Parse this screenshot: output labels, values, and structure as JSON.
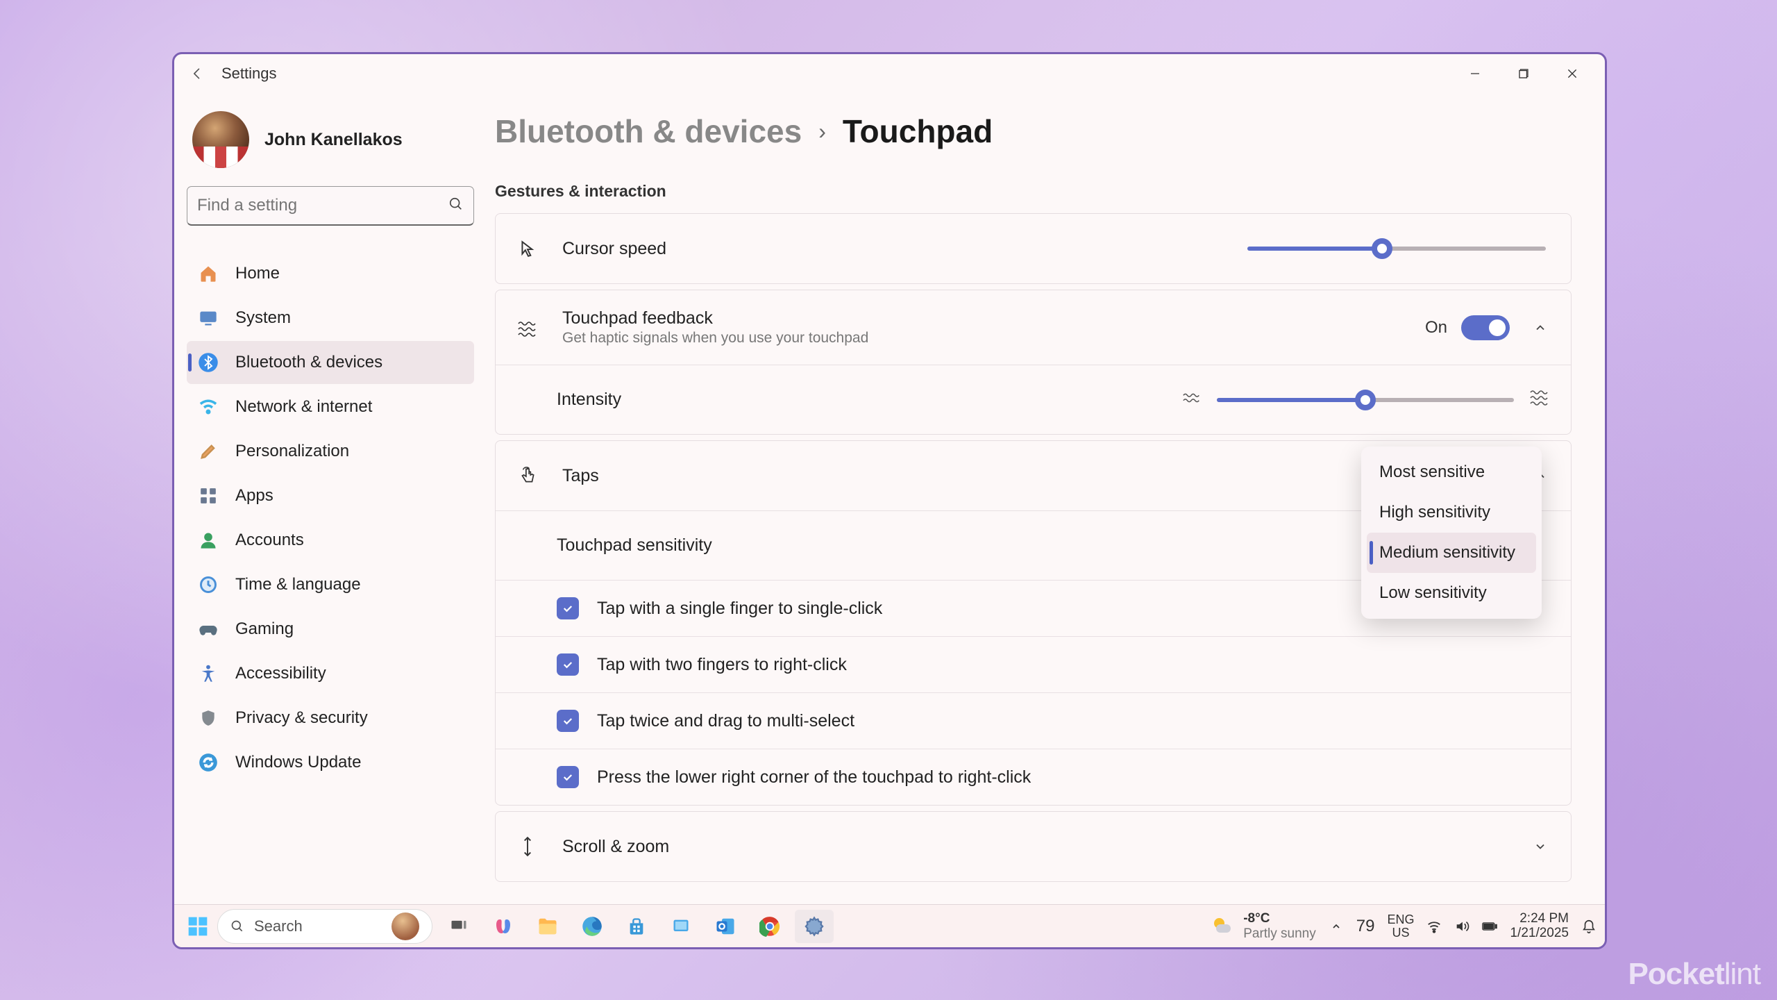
{
  "app_title": "Settings",
  "user": {
    "name": "John Kanellakos"
  },
  "search": {
    "placeholder": "Find a setting"
  },
  "nav": [
    {
      "id": "home",
      "label": "Home"
    },
    {
      "id": "system",
      "label": "System"
    },
    {
      "id": "bluetooth",
      "label": "Bluetooth & devices",
      "active": true
    },
    {
      "id": "network",
      "label": "Network & internet"
    },
    {
      "id": "personalization",
      "label": "Personalization"
    },
    {
      "id": "apps",
      "label": "Apps"
    },
    {
      "id": "accounts",
      "label": "Accounts"
    },
    {
      "id": "time",
      "label": "Time & language"
    },
    {
      "id": "gaming",
      "label": "Gaming"
    },
    {
      "id": "accessibility",
      "label": "Accessibility"
    },
    {
      "id": "privacy",
      "label": "Privacy & security"
    },
    {
      "id": "update",
      "label": "Windows Update"
    }
  ],
  "breadcrumb": {
    "parent": "Bluetooth & devices",
    "current": "Touchpad"
  },
  "section": {
    "label": "Gestures & interaction"
  },
  "settings": {
    "cursor_speed": {
      "label": "Cursor speed",
      "value_pct": 45
    },
    "feedback": {
      "label": "Touchpad feedback",
      "sub": "Get haptic signals when you use your touchpad",
      "toggle_label": "On",
      "on": true,
      "intensity": {
        "label": "Intensity",
        "value_pct": 50
      }
    },
    "taps": {
      "label": "Taps",
      "sensitivity": {
        "label": "Touchpad sensitivity"
      },
      "checks": [
        {
          "label": "Tap with a single finger to single-click",
          "checked": true
        },
        {
          "label": "Tap with two fingers to right-click",
          "checked": true
        },
        {
          "label": "Tap twice and drag to multi-select",
          "checked": true
        },
        {
          "label": "Press the lower right corner of the touchpad to right-click",
          "checked": true
        }
      ]
    },
    "scroll_zoom": {
      "label": "Scroll & zoom"
    }
  },
  "dropdown": {
    "items": [
      "Most sensitive",
      "High sensitivity",
      "Medium sensitivity",
      "Low sensitivity"
    ],
    "selected_index": 2
  },
  "taskbar": {
    "search": {
      "placeholder": "Search"
    },
    "weather": {
      "temp": "-8°C",
      "desc": "Partly sunny"
    },
    "tray_num": "79",
    "lang": {
      "top": "ENG",
      "bottom": "US"
    },
    "clock": {
      "time": "2:24 PM",
      "date": "1/21/2025"
    }
  },
  "watermark": {
    "a": "Pocket",
    "b": "lint"
  }
}
